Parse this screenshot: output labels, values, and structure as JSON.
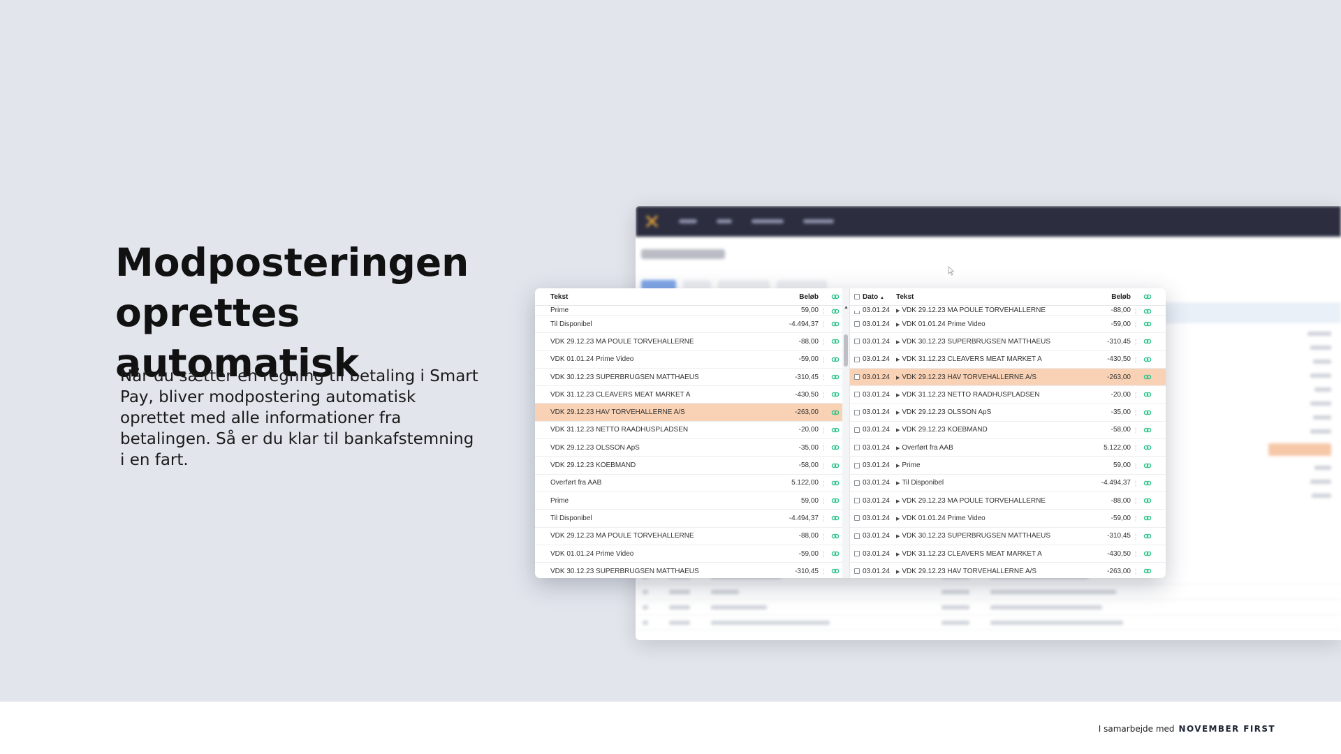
{
  "headline": [
    "Modposteringen",
    "oprettes automatisk"
  ],
  "body_text": "Når du sætter en regning til betaling i Smart Pay, bliver modpostering automatisk oprettet med alle informationer fra betalingen. Så er du klar til bankafstemning i en fart.",
  "footer": {
    "prefix": "I samarbejde med",
    "brand": "NOVEMBER FIRST"
  },
  "colors": {
    "highlight_row": "#f9d2b5",
    "link_icon": "#2fc38a",
    "nav_bar": "#2c2e40"
  },
  "left_table": {
    "headers": {
      "text": "Tekst",
      "amount": "Beløb",
      "link_icon": "link-icon"
    },
    "partial_row": {
      "text": "Prime",
      "amount": "59,00"
    },
    "rows": [
      {
        "text": "Til Disponibel",
        "amount": "-4.494,37"
      },
      {
        "text": "VDK 29.12.23 MA POULE TORVEHALLERNE",
        "amount": "-88,00"
      },
      {
        "text": "VDK 01.01.24 Prime Video",
        "amount": "-59,00"
      },
      {
        "text": "VDK 30.12.23 SUPERBRUGSEN MATTHAEUS",
        "amount": "-310,45"
      },
      {
        "text": "VDK 31.12.23 CLEAVERS MEAT MARKET A",
        "amount": "-430,50"
      },
      {
        "text": "VDK 29.12.23 HAV TORVEHALLERNE A/S",
        "amount": "-263,00",
        "highlight": true
      },
      {
        "text": "VDK 31.12.23 NETTO RAADHUSPLADSEN",
        "amount": "-20,00"
      },
      {
        "text": "VDK 29.12.23 OLSSON ApS",
        "amount": "-35,00"
      },
      {
        "text": "VDK 29.12.23  KOEBMAND",
        "amount": "-58,00"
      },
      {
        "text": "Overført fra AAB",
        "amount": "5.122,00"
      },
      {
        "text": "Prime",
        "amount": "59,00"
      },
      {
        "text": "Til Disponibel",
        "amount": "-4.494,37"
      },
      {
        "text": "VDK 29.12.23 MA POULE TORVEHALLERNE",
        "amount": "-88,00"
      },
      {
        "text": "VDK 01.01.24 Prime Video",
        "amount": "-59,00"
      },
      {
        "text": "VDK 30.12.23 SUPERBRUGSEN MATTHAEUS",
        "amount": "-310,45"
      }
    ]
  },
  "right_table": {
    "headers": {
      "date": "Dato",
      "sort_indicator": "▲",
      "text": "Tekst",
      "amount": "Beløb",
      "link_icon": "link-icon"
    },
    "partial_row": {
      "date": "03.01.24",
      "text": "VDK 29.12.23 MA POULE TORVEHALLERNE",
      "amount": "-88,00"
    },
    "rows": [
      {
        "date": "03.01.24",
        "text": "VDK 01.01.24 Prime Video",
        "amount": "-59,00"
      },
      {
        "date": "03.01.24",
        "text": "VDK 30.12.23 SUPERBRUGSEN MATTHAEUS",
        "amount": "-310,45"
      },
      {
        "date": "03.01.24",
        "text": "VDK 31.12.23 CLEAVERS MEAT MARKET A",
        "amount": "-430,50"
      },
      {
        "date": "03.01.24",
        "text": "VDK 29.12.23 HAV TORVEHALLERNE A/S",
        "amount": "-263,00",
        "highlight": true
      },
      {
        "date": "03.01.24",
        "text": "VDK 31.12.23 NETTO RAADHUSPLADSEN",
        "amount": "-20,00"
      },
      {
        "date": "03.01.24",
        "text": "VDK 29.12.23 OLSSON ApS",
        "amount": "-35,00"
      },
      {
        "date": "03.01.24",
        "text": "VDK 29.12.23  KOEBMAND",
        "amount": "-58,00"
      },
      {
        "date": "03.01.24",
        "text": "Overført fra AAB",
        "amount": "5.122,00"
      },
      {
        "date": "03.01.24",
        "text": "Prime",
        "amount": "59,00"
      },
      {
        "date": "03.01.24",
        "text": "Til Disponibel",
        "amount": "-4.494,37"
      },
      {
        "date": "03.01.24",
        "text": "VDK 29.12.23 MA POULE TORVEHALLERNE",
        "amount": "-88,00"
      },
      {
        "date": "03.01.24",
        "text": "VDK 01.01.24 Prime Video",
        "amount": "-59,00"
      },
      {
        "date": "03.01.24",
        "text": "VDK 30.12.23 SUPERBRUGSEN MATTHAEUS",
        "amount": "-310,45"
      },
      {
        "date": "03.01.24",
        "text": "VDK 31.12.23 CLEAVERS MEAT MARKET A",
        "amount": "-430,50"
      },
      {
        "date": "03.01.24",
        "text": "VDK 29.12.23 HAV TORVEHALLERNE A/S",
        "amount": "-263,00"
      }
    ]
  }
}
